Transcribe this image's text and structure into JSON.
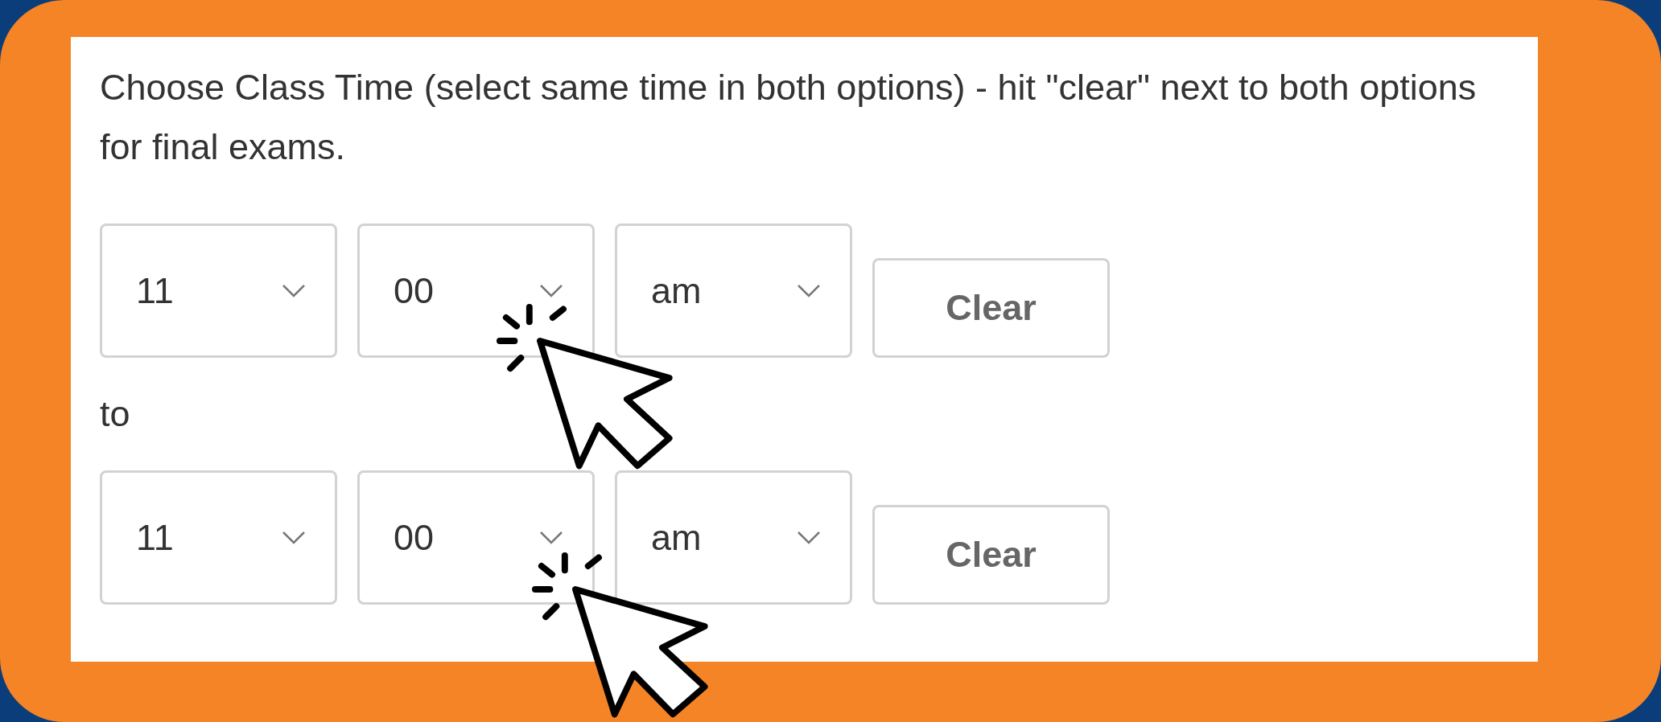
{
  "instruction": "Choose Class Time (select same time in both options) - hit \"clear\" next to both options for final exams.",
  "rows": [
    {
      "hour": "11",
      "minute": "00",
      "period": "am",
      "clear": "Clear"
    },
    {
      "hour": "11",
      "minute": "00",
      "period": "am",
      "clear": "Clear"
    }
  ],
  "separator": "to"
}
